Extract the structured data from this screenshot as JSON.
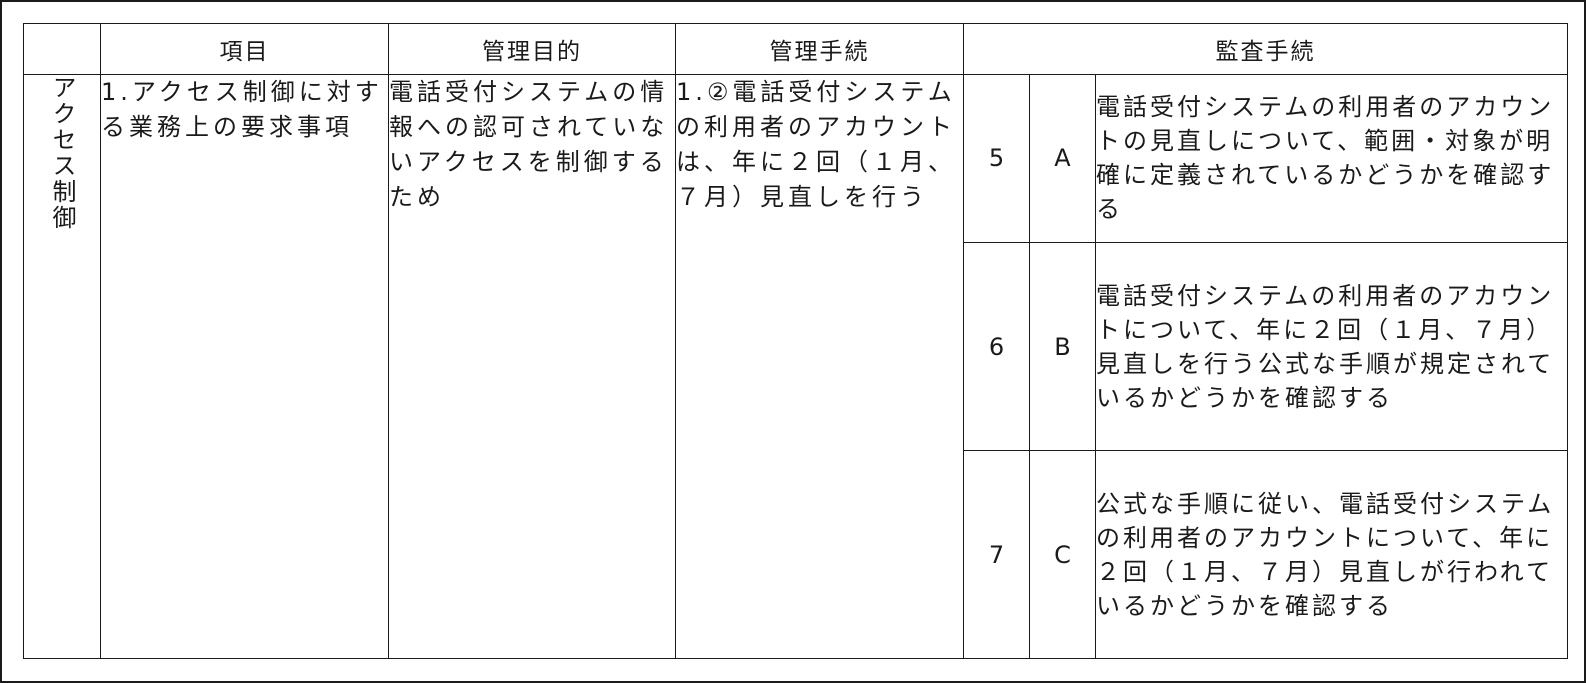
{
  "headers": {
    "blank": "",
    "item": "項目",
    "objective": "管理目的",
    "procedure": "管理手続",
    "audit": "監査手続"
  },
  "category": "アクセス制御",
  "item_text": "1.アクセス制御に対する業務上の要求事項",
  "objective_text": "電話受付システムの情報への認可されていないアクセスを制御するため",
  "procedure_text": "1.②電話受付システムの利用者のアカウントは、年に２回（１月、７月）見直しを行う",
  "audit_rows": [
    {
      "number": "5",
      "letter": "A",
      "text": "電話受付システムの利用者のアカウントの見直しについて、範囲・対象が明確に定義されているかどうかを確認する"
    },
    {
      "number": "6",
      "letter": "B",
      "text": "電話受付システムの利用者のアカウントについて、年に２回（１月、７月）見直しを行う公式な手順が規定されているかどうかを確認する"
    },
    {
      "number": "7",
      "letter": "C",
      "text": "公式な手順に従い、電話受付システムの利用者のアカウントについて、年に２回（１月、７月）見直しが行われているかどうかを確認する"
    }
  ]
}
